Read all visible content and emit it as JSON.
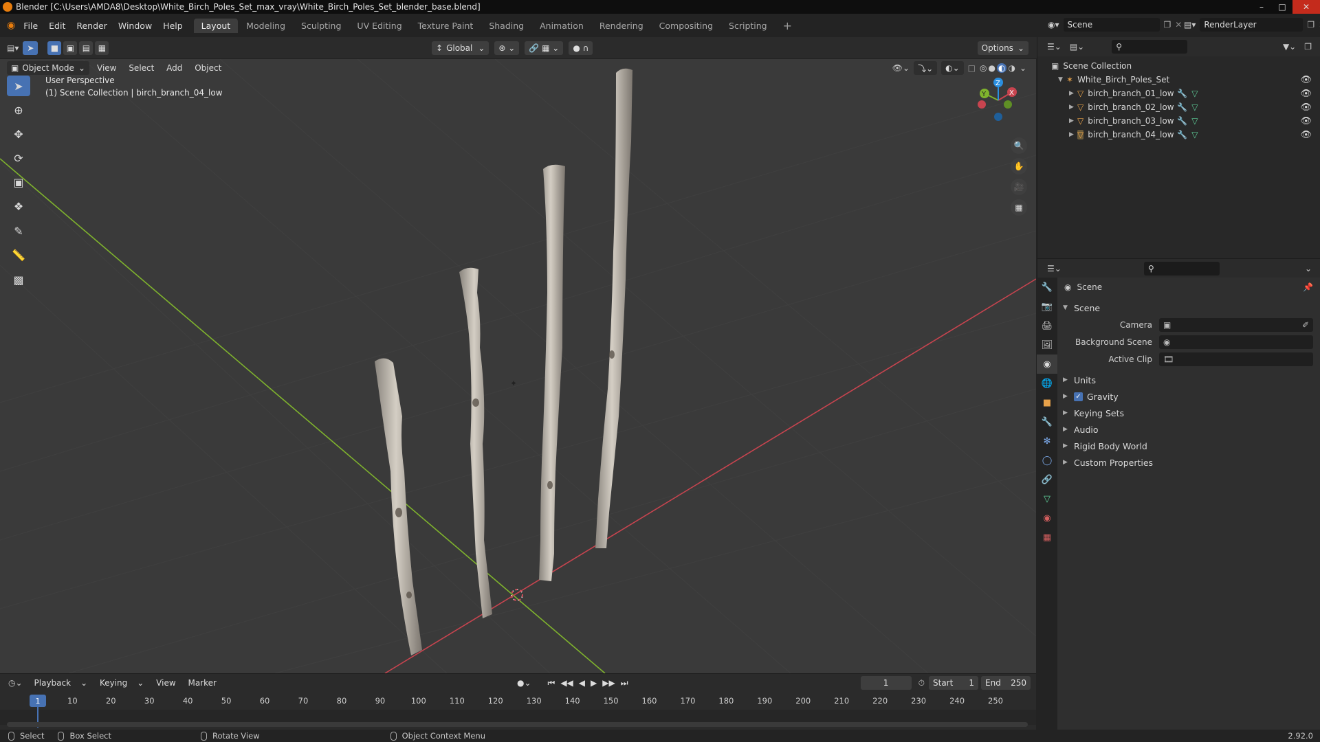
{
  "title": "Blender [C:\\Users\\AMDA8\\Desktop\\White_Birch_Poles_Set_max_vray\\White_Birch_Poles_Set_blender_base.blend]",
  "menu": [
    "File",
    "Edit",
    "Render",
    "Window",
    "Help"
  ],
  "workspaces": [
    "Layout",
    "Modeling",
    "Sculpting",
    "UV Editing",
    "Texture Paint",
    "Shading",
    "Animation",
    "Rendering",
    "Compositing",
    "Scripting"
  ],
  "scene_field": "Scene",
  "render_layer_field": "RenderLayer",
  "viewport": {
    "mode": "Object Mode",
    "menus": [
      "View",
      "Select",
      "Add",
      "Object"
    ],
    "orientation": "Global",
    "options": "Options",
    "perspective": "User Perspective",
    "collection_info": "(1) Scene Collection | birch_branch_04_low",
    "gizmo_axes": [
      "X",
      "Y",
      "Z"
    ]
  },
  "outliner": {
    "root": "Scene Collection",
    "collection": "White_Birch_Poles_Set",
    "objects": [
      "birch_branch_01_low",
      "birch_branch_02_low",
      "birch_branch_03_low",
      "birch_branch_04_low"
    ]
  },
  "properties": {
    "context": "Scene",
    "panel": "Scene",
    "fields": [
      {
        "label": "Camera",
        "value": ""
      },
      {
        "label": "Background Scene",
        "value": ""
      },
      {
        "label": "Active Clip",
        "value": ""
      }
    ],
    "sections": [
      "Units",
      "Gravity",
      "Keying Sets",
      "Audio",
      "Rigid Body World",
      "Custom Properties"
    ],
    "gravity_checked": true
  },
  "timeline": {
    "menus": [
      "Playback",
      "Keying",
      "View",
      "Marker"
    ],
    "current_frame": "1",
    "start_label": "Start",
    "start": "1",
    "end_label": "End",
    "end": "250",
    "ticks": [
      "1",
      "10",
      "20",
      "30",
      "40",
      "50",
      "60",
      "70",
      "80",
      "90",
      "100",
      "110",
      "120",
      "130",
      "140",
      "150",
      "160",
      "170",
      "180",
      "190",
      "200",
      "210",
      "220",
      "230",
      "240",
      "250"
    ]
  },
  "statusbar": {
    "select": "Select",
    "box_select": "Box Select",
    "rotate_view": "Rotate View",
    "context_menu": "Object Context Menu",
    "version": "2.92.0"
  },
  "colors": {
    "accent": "#4772b3",
    "x_axis": "#c8444f",
    "y_axis": "#7fb32d",
    "z_axis": "#2a8fe0"
  }
}
